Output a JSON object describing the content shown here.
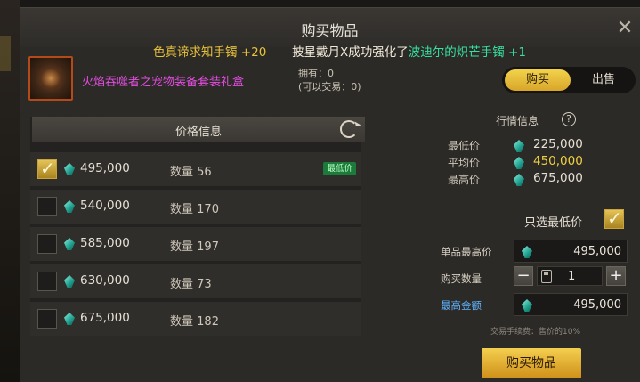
{
  "window": {
    "title": "购买物品"
  },
  "ticker": {
    "left": "色真谛求知手镯 +20",
    "right_prefix": "披星戴月X成功强化了",
    "right_item": "波迪尔的炽芒手镯 +1"
  },
  "item": {
    "name": "火焰吞噬者之宠物装备套装礼盒",
    "own_label": "拥有：0",
    "tradable_label": "(可以交易：0)"
  },
  "mode_toggle": {
    "buy_label": "购买",
    "sell_label": "出售",
    "selected": "购买"
  },
  "price_panel": {
    "title": "价格信息",
    "qty_label": "数量",
    "rows": [
      {
        "price": "495,000",
        "qty": "56",
        "checked": true,
        "badge": "最低价"
      },
      {
        "price": "540,000",
        "qty": "170",
        "checked": false,
        "badge": ""
      },
      {
        "price": "585,000",
        "qty": "197",
        "checked": false,
        "badge": ""
      },
      {
        "price": "630,000",
        "qty": "73",
        "checked": false,
        "badge": ""
      },
      {
        "price": "675,000",
        "qty": "182",
        "checked": false,
        "badge": ""
      }
    ]
  },
  "market": {
    "title": "行情信息",
    "min_label": "最低价",
    "min_value": "225,000",
    "avg_label": "平均价",
    "avg_value": "450,000",
    "max_label": "最高价",
    "max_value": "675,000"
  },
  "purchase": {
    "only_lowest_label": "只选最低价",
    "only_lowest_checked": true,
    "unit_max_label": "单品最高价",
    "unit_max_value": "495,000",
    "qty_label": "购买数量",
    "qty_value": "1",
    "total_label": "最高金额",
    "total_value": "495,000",
    "fee_note": "交易手续费：售价的10%",
    "buy_button": "购买物品"
  },
  "colors": {
    "accent_gold": "#f2d24b",
    "item_name": "#e24de0",
    "lowest_badge": "#1c7a3a",
    "avg_price": "#f0cf40"
  }
}
